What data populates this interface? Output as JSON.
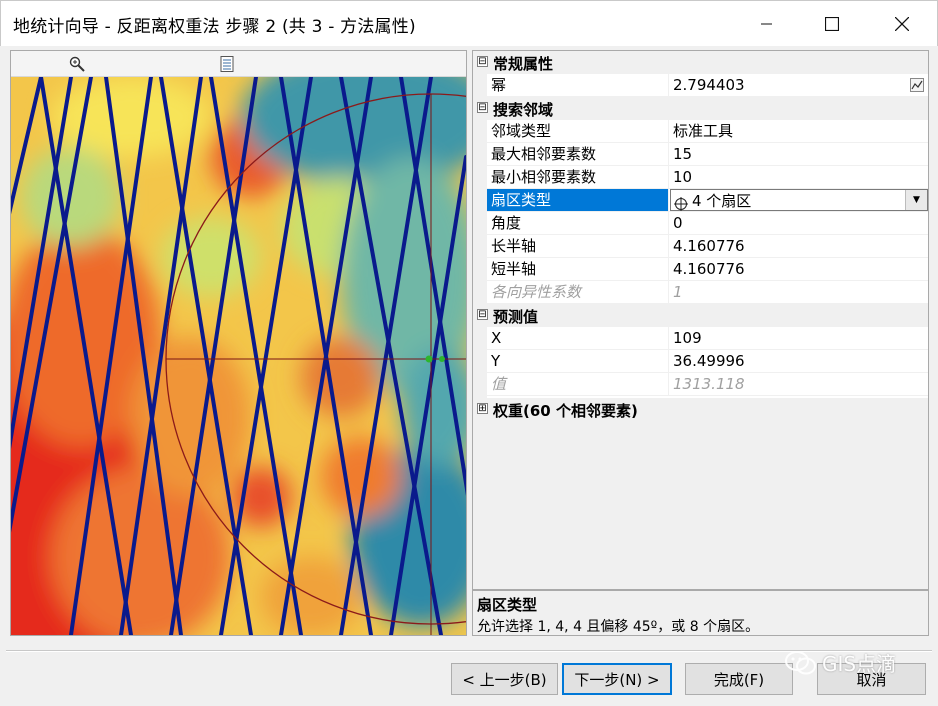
{
  "window": {
    "title": "地统计向导 - 反距离权重法 步骤 2 (共 3 - 方法属性)",
    "minimize_icon": "minimize-icon",
    "maximize_icon": "maximize-icon",
    "close_icon": "close-icon"
  },
  "map": {
    "toolbar": {
      "zoom_icon": "zoom-in-icon",
      "list_icon": "list-icon"
    },
    "colors": {
      "high": "#e8231a",
      "mid": "#f5e45a",
      "low": "#2e8ba5",
      "points": "#0a1a8c",
      "circle": "#8b1a1a",
      "crosshair": "#7a1414",
      "center": "#2db52d"
    }
  },
  "properties": {
    "groups": [
      {
        "label": "常规属性",
        "expander": "⊟"
      },
      {
        "label": "搜索邻域",
        "expander": "⊟"
      },
      {
        "label": "预测值",
        "expander": "⊟"
      },
      {
        "label": "权重(60 个相邻要素)",
        "expander": "⊞"
      }
    ],
    "general": [
      {
        "key": "幂",
        "value": "2.794403"
      }
    ],
    "search": [
      {
        "key": "邻域类型",
        "value": "标准工具"
      },
      {
        "key": "最大相邻要素数",
        "value": "15"
      },
      {
        "key": "最小相邻要素数",
        "value": "10"
      },
      {
        "key": "扇区类型",
        "value": "4 个扇区"
      },
      {
        "key": "角度",
        "value": "0"
      },
      {
        "key": "长半轴",
        "value": "4.160776"
      },
      {
        "key": "短半轴",
        "value": "4.160776"
      },
      {
        "key": "各向异性系数",
        "value": "1"
      }
    ],
    "predict": [
      {
        "key": "X",
        "value": "109"
      },
      {
        "key": "Y",
        "value": "36.49996"
      },
      {
        "key": "值",
        "value": "1313.118"
      }
    ]
  },
  "description": {
    "title": "扇区类型",
    "text": "允许选择 1, 4, 4 且偏移 45º，或 8 个扇区。"
  },
  "buttons": {
    "prev": "< 上一步(B)",
    "next": "下一步(N) >",
    "finish": "完成(F)",
    "cancel": "取消"
  },
  "watermark": {
    "text": "GIS点滴"
  }
}
